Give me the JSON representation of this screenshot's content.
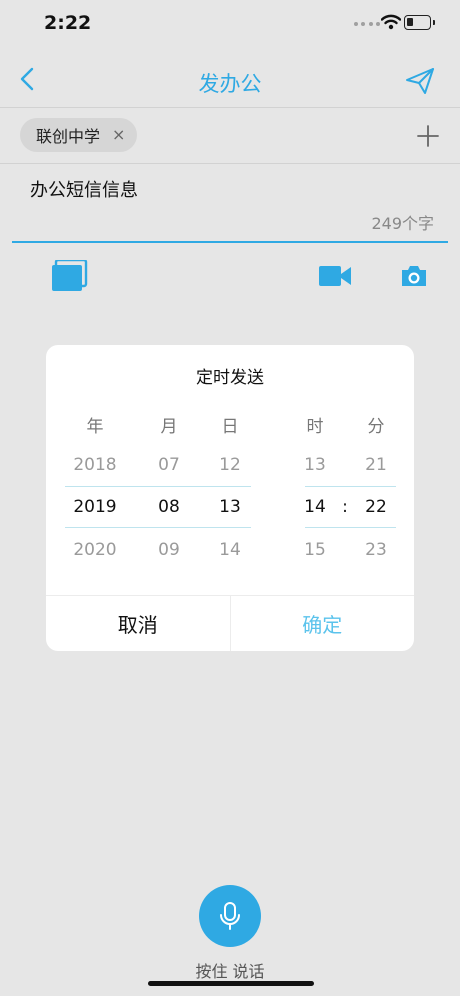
{
  "status_bar": {
    "time": "2:22"
  },
  "nav": {
    "title": "发办公"
  },
  "recipients": {
    "items": [
      {
        "name": "联创中学",
        "remove": "×"
      }
    ]
  },
  "message": {
    "text": "办公短信信息",
    "char_count": "249个字"
  },
  "dialog": {
    "title": "定时发送",
    "headers": {
      "year": "年",
      "month": "月",
      "day": "日",
      "hour": "时",
      "minute": "分"
    },
    "year": {
      "prev": "2018",
      "selected": "2019",
      "next": "2020"
    },
    "month": {
      "prev": "07",
      "selected": "08",
      "next": "09"
    },
    "day": {
      "prev": "12",
      "selected": "13",
      "next": "14"
    },
    "hour": {
      "prev": "13",
      "selected": "14",
      "next": "15"
    },
    "minute": {
      "prev": "21",
      "selected": "22",
      "next": "23"
    },
    "time_separator": ":",
    "cancel_label": "取消",
    "confirm_label": "确定"
  },
  "voice": {
    "label": "按住 说话"
  },
  "colors": {
    "accent": "#2fa9e3",
    "confirm": "#5bc3ec",
    "background": "#e6e6e6"
  },
  "icons": {
    "back": "chevron-left-icon",
    "send": "paper-plane-icon",
    "add": "plus-icon",
    "album": "album-icon",
    "video": "video-camera-icon",
    "camera": "camera-icon",
    "mic": "microphone-icon"
  }
}
